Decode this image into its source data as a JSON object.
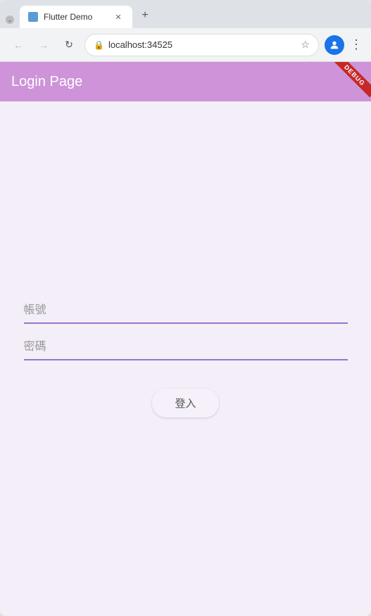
{
  "browser": {
    "tab_title": "Flutter Demo",
    "url": "localhost:34525",
    "new_tab_icon": "+",
    "back_icon": "←",
    "forward_icon": "→",
    "refresh_icon": "↻",
    "star_icon": "☆",
    "menu_icon": "⋮"
  },
  "app": {
    "title": "Login Page",
    "debug_label": "DEBUG"
  },
  "form": {
    "username_placeholder": "帳號",
    "password_placeholder": "密碼",
    "login_button_label": "登入"
  }
}
